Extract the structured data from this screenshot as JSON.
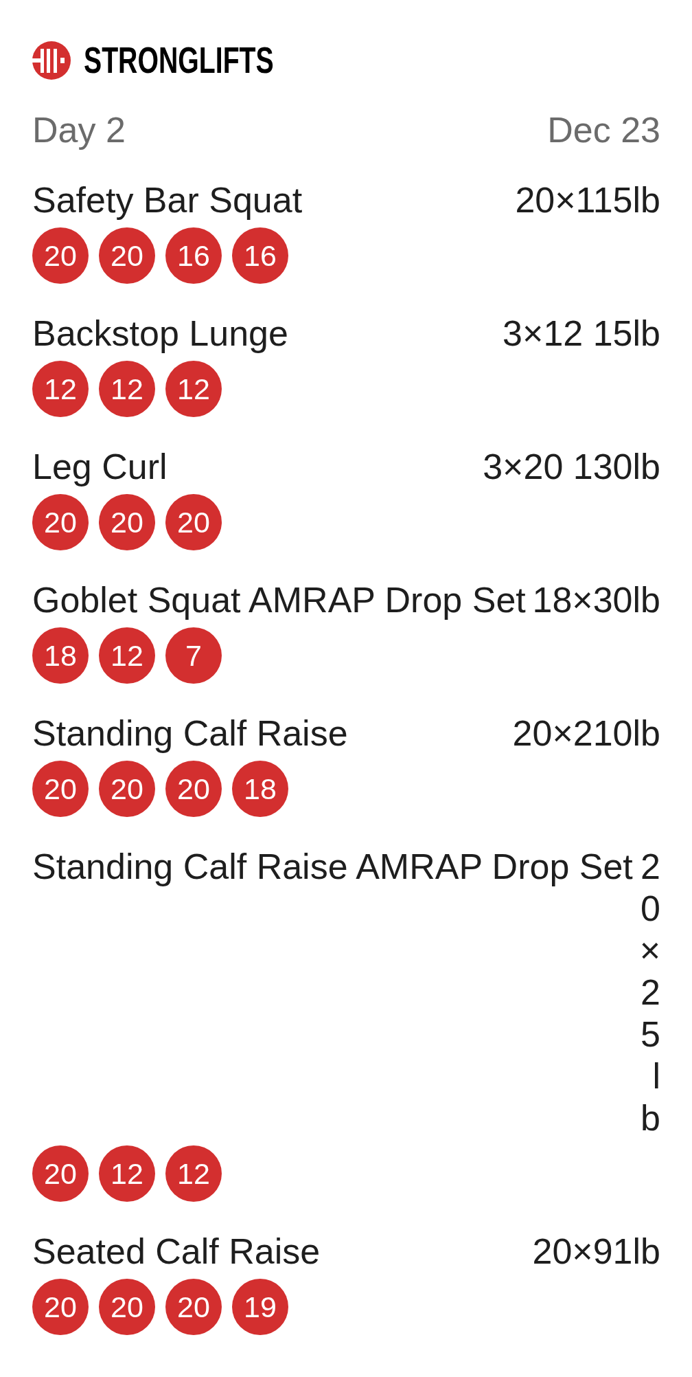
{
  "brand": {
    "name": "STRONGLIFTS"
  },
  "workout": {
    "day": "Day 2",
    "date": "Dec 23"
  },
  "exercises": [
    {
      "name": "Safety Bar Squat",
      "weight": "20×115lb",
      "sets": [
        "20",
        "20",
        "16",
        "16"
      ]
    },
    {
      "name": "Backstop Lunge",
      "weight": "3×12 15lb",
      "sets": [
        "12",
        "12",
        "12"
      ]
    },
    {
      "name": "Leg Curl",
      "weight": "3×20 130lb",
      "sets": [
        "20",
        "20",
        "20"
      ]
    },
    {
      "name": "Goblet Squat AMRAP Drop Set",
      "weight": "18×30lb",
      "sets": [
        "18",
        "12",
        "7"
      ]
    },
    {
      "name": "Standing Calf Raise",
      "weight": "20×210lb",
      "sets": [
        "20",
        "20",
        "20",
        "18"
      ]
    },
    {
      "name": "Standing Calf Raise AMRAP Drop Set",
      "weight": "20×25lb",
      "sets": [
        "20",
        "12",
        "12"
      ]
    },
    {
      "name": "Seated Calf Raise",
      "weight": "20×91lb",
      "sets": [
        "20",
        "20",
        "20",
        "19"
      ]
    }
  ]
}
